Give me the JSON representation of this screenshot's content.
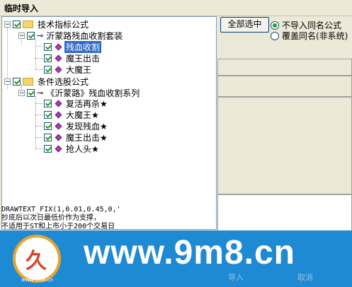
{
  "window": {
    "title": "临时导入"
  },
  "tree": {
    "group1": {
      "label": "技术指标公式",
      "sub": {
        "label": "沂蒙路残血收割套装",
        "items": [
          "残血收割",
          "魔王出击",
          "大魔王"
        ]
      }
    },
    "group2": {
      "label": "条件选股公式",
      "sub": {
        "label": "《沂蒙路》残血收割系列",
        "items": [
          "复活再杀★",
          "大魔王★",
          "发现残血★",
          "魔王出击★",
          "抢人头★"
        ]
      }
    }
  },
  "controls": {
    "select_all": "全部选中",
    "radio1": "不导入同名公式",
    "radio2": "覆盖同名(非系统)"
  },
  "formula_text": "DRAWTEXT_FIX(1,0.01,0.45,0,'\n抄底后以次日最低价作为支撑，\n不适用于ST和上市小于200个交易日",
  "watermark": {
    "text": "www.9m8.cn",
    "logo_text": "久",
    "logo_sub": "www.9m8.cn"
  },
  "ghost_text": [
    "导入",
    "取消"
  ]
}
